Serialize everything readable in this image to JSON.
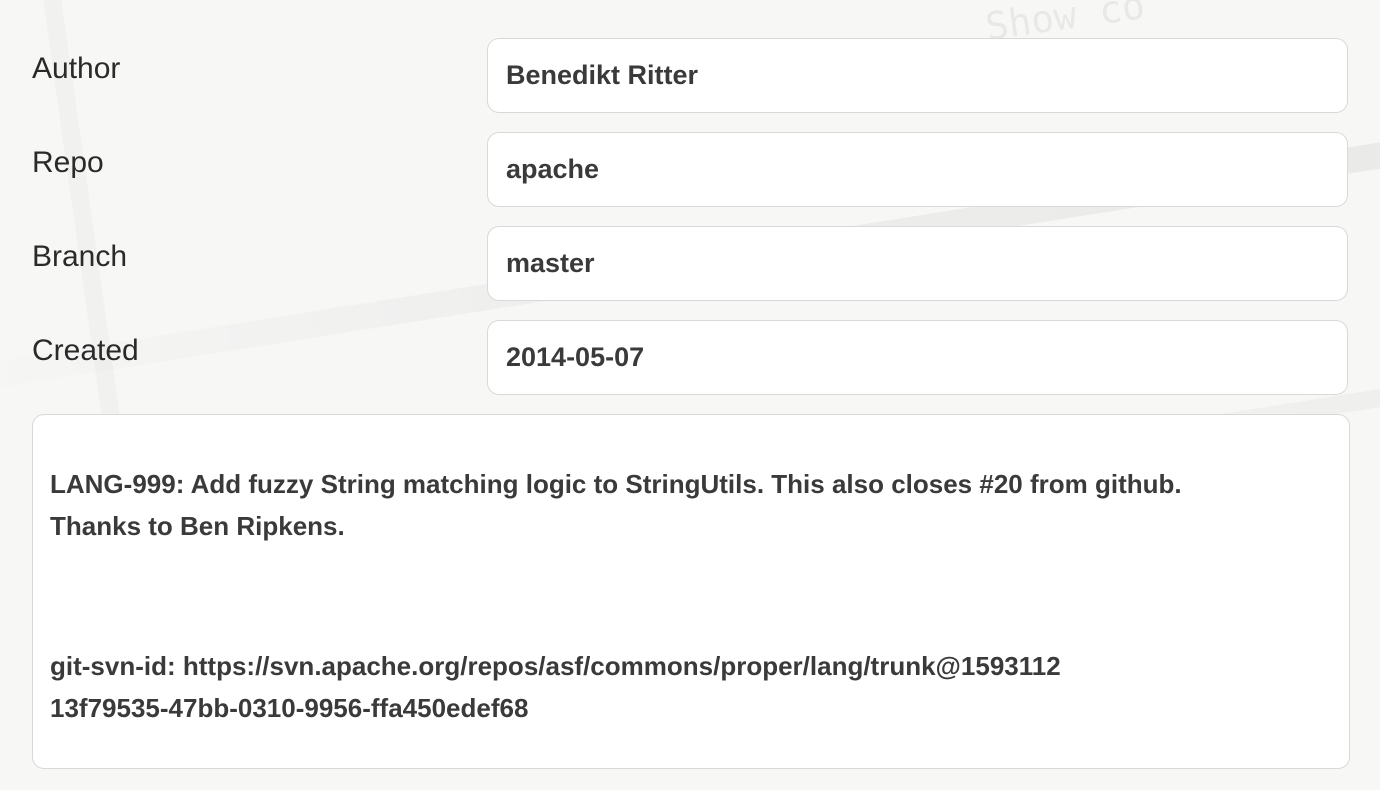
{
  "fields": [
    {
      "label": "Author",
      "value": "Benedikt Ritter"
    },
    {
      "label": "Repo",
      "value": "apache"
    },
    {
      "label": "Branch",
      "value": "master"
    },
    {
      "label": "Created",
      "value": "2014-05-07"
    }
  ],
  "message": {
    "line1": "LANG-999: Add fuzzy String matching logic to StringUtils. This also closes #20 from github.",
    "line2": "Thanks to Ben Ripkens.",
    "line3": "git-svn-id: https://svn.apache.org/repos/asf/commons/proper/lang/trunk@1593112",
    "line4": "13f79535-47bb-0310-9956-ffa450edef68"
  },
  "background": {
    "ghost_text": "Show co"
  }
}
